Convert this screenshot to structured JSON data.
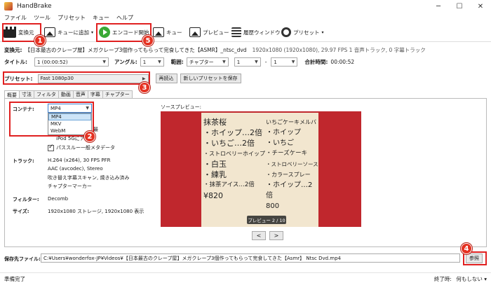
{
  "window": {
    "title": "HandBrake"
  },
  "menu": [
    "ファイル",
    "ツール",
    "プリセット",
    "キュー",
    "ヘルプ"
  ],
  "toolbar": {
    "open": "変換元",
    "add_queue": "キューに追加",
    "start": "エンコード開始",
    "queue": "キュー",
    "preview": "プレビュー",
    "history": "履歴ウィンドウ",
    "presets": "プリセット"
  },
  "source": {
    "label": "変換元:",
    "name": "【日本最古のクレープ屋】メガクレープ3個作ってもらって完食してきた【ASMR】_ntsc_dvd",
    "info": "1920x1080 (1920x1080), 29.97 FPS 1 音声トラック, 0 字幕トラック"
  },
  "title_row": {
    "title_label": "タイトル:",
    "title_value": "1 (00:00:52)",
    "angle_label": "アングル:",
    "angle_value": "1",
    "range_label": "範囲:",
    "range_type": "チャプター",
    "range_start": "1",
    "range_sep": "-",
    "range_end": "1",
    "duration_label": "合計時間:",
    "duration_value": "00:00:52"
  },
  "preset_row": {
    "label": "プリセット:",
    "value": "Fast 1080p30",
    "reload": "再読込",
    "save_new": "新しいプリセットを保存"
  },
  "tabs": [
    "概要",
    "寸法",
    "フィルタ",
    "動画",
    "音声",
    "字幕",
    "チャプター"
  ],
  "summary": {
    "container_label": "コンテナ:",
    "container_value": "MP4",
    "container_options": [
      "MP4",
      "MKV",
      "WebM"
    ],
    "opt_partial_1": "最",
    "opt_partial_2": "iPod 5Gにア",
    "passthru": "パススルー一般メタデータ",
    "tracks_label": "トラック:",
    "tracks": [
      "H.264 (x264), 30 FPS PFR",
      "AAC (avcodec), Stereo",
      "吹き替え字幕スキャン, 焼き込み済み",
      "チャプターマーカー"
    ],
    "filters_label": "フィルター:",
    "filters_value": "Decomb",
    "size_label": "サイズ:",
    "size_value": "1920x1080 ストレージ, 1920x1080 表示"
  },
  "preview": {
    "label": "ソースプレビュー:",
    "counter": "プレビュー 2 / 10",
    "prev": "<",
    "next": ">",
    "menu_left": [
      "抹茶桜",
      "・ホイップ…2倍",
      "・いちご…2倍",
      "・ストロベリーホイップ",
      "・白玉",
      "・練乳",
      "・抹茶アイス…2倍",
      "¥820"
    ],
    "menu_right": [
      "いちごケーキメルバ",
      "・ホイップ",
      "・いちご",
      "・チーズケーキ",
      "・ストロベリーソース",
      "・カラースプレー",
      "・ホイップ…2倍",
      "800"
    ]
  },
  "destination": {
    "label": "保存先ファイル:",
    "path": "C:¥Users¥wonderfox-JP¥Videos¥【日本最古のクレープ屋】メガクレープ3個作ってもらって完食してきた【Asmr】 Ntsc Dvd.mp4",
    "browse": "参照"
  },
  "status": {
    "left": "準備完了",
    "when_done_label": "終了時:",
    "when_done_value": "何もしない"
  },
  "annotations": [
    "1",
    "2",
    "3",
    "4",
    "5"
  ],
  "colors": {
    "annotation_red": "#e02020",
    "start_green": "#3aa935",
    "preview_bg": "#c0272d"
  }
}
